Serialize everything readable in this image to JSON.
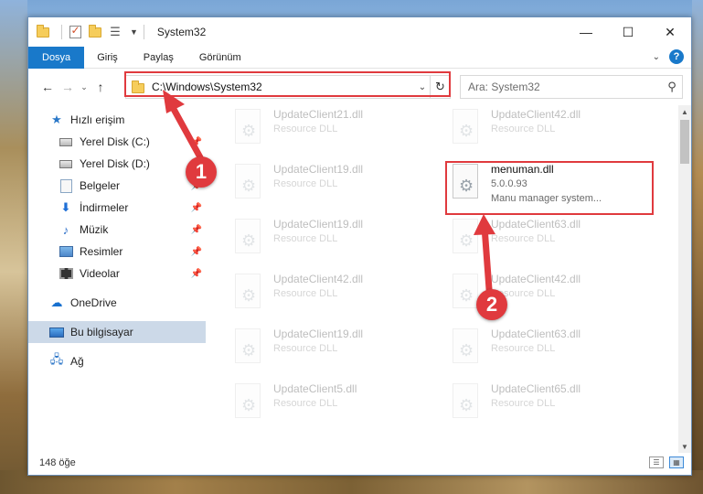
{
  "window": {
    "title": "System32",
    "controls": {
      "minimize": "—",
      "maximize": "☐",
      "close": "✕"
    }
  },
  "ribbon": {
    "tabs": [
      {
        "label": "Dosya",
        "active": true
      },
      {
        "label": "Giriş",
        "active": false
      },
      {
        "label": "Paylaş",
        "active": false
      },
      {
        "label": "Görünüm",
        "active": false
      }
    ],
    "help": "?"
  },
  "address": {
    "path": "C:\\Windows\\System32"
  },
  "search": {
    "placeholder": "Ara: System32"
  },
  "sidebar": {
    "quick_access": "Hızlı erişim",
    "items": [
      {
        "label": "Yerel Disk (C:)",
        "icon": "disk-icon",
        "pinned": true
      },
      {
        "label": "Yerel Disk (D:)",
        "icon": "disk-icon",
        "pinned": false
      },
      {
        "label": "Belgeler",
        "icon": "documents-icon",
        "pinned": true
      },
      {
        "label": "İndirmeler",
        "icon": "download-icon",
        "pinned": true
      },
      {
        "label": "Müzik",
        "icon": "music-icon",
        "pinned": true
      },
      {
        "label": "Resimler",
        "icon": "pictures-icon",
        "pinned": true
      },
      {
        "label": "Videolar",
        "icon": "videos-icon",
        "pinned": true
      }
    ],
    "onedrive": "OneDrive",
    "this_pc": "Bu bilgisayar",
    "network": "Ağ"
  },
  "files": {
    "left_column": [
      {
        "name": "UpdateClient21.dll",
        "type": "Resource DLL"
      },
      {
        "name": "UpdateClient19.dll",
        "type": "Resource DLL"
      },
      {
        "name": "UpdateClient19.dll",
        "type": "Resource DLL"
      },
      {
        "name": "UpdateClient42.dll",
        "type": "Resource DLL"
      },
      {
        "name": "UpdateClient19.dll",
        "type": "Resource DLL"
      },
      {
        "name": "UpdateClient5.dll",
        "type": "Resource DLL"
      }
    ],
    "right_column": [
      {
        "name": "UpdateClient42.dll",
        "type": "Resource DLL"
      },
      {
        "name": "UpdateClient63.dll",
        "type": "Resource DLL"
      },
      {
        "name": "UpdateClient42.dll",
        "type": "Resource DLL"
      },
      {
        "name": "UpdateClient63.dll",
        "type": "Resource DLL"
      },
      {
        "name": "UpdateClient65.dll",
        "type": "Resource DLL"
      }
    ],
    "highlighted": {
      "name": "menuman.dll",
      "version": "5.0.0.93",
      "description": "Manu manager system..."
    }
  },
  "status": {
    "item_count": "148 öğe"
  },
  "callouts": {
    "one": "1",
    "two": "2"
  },
  "colors": {
    "accent": "#1979ca",
    "highlight_red": "#e03a3e"
  }
}
